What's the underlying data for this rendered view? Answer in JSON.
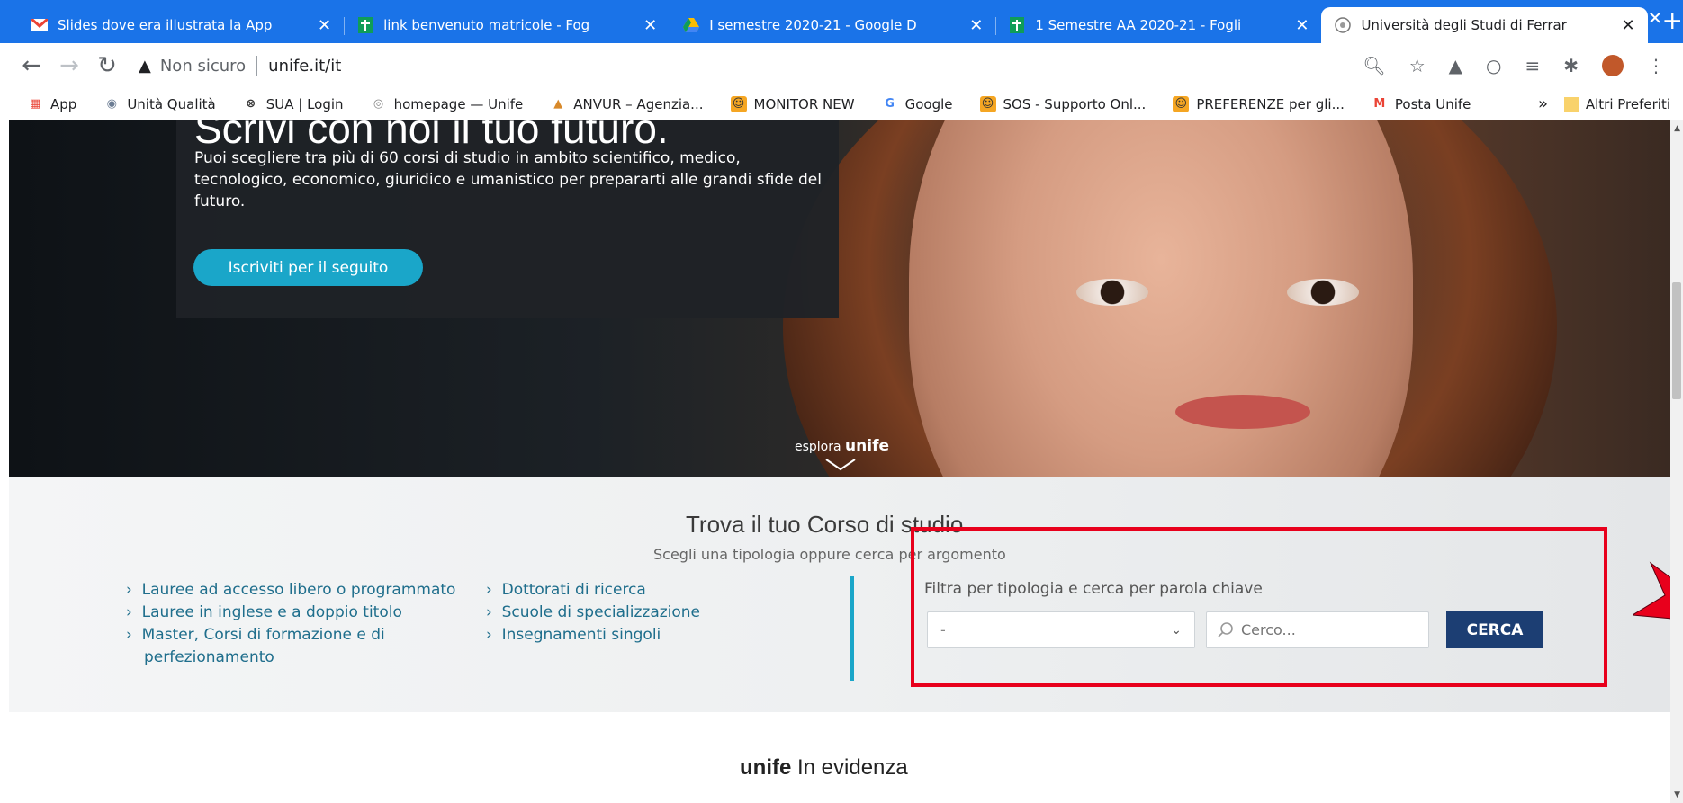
{
  "browser": {
    "tabs": [
      {
        "title": "Slides dove era illustrata la App",
        "icon": "gmail-icon"
      },
      {
        "title": "link benvenuto matricole - Fog",
        "icon": "sheets-icon"
      },
      {
        "title": "I semestre 2020-21 - Google D",
        "icon": "drive-icon"
      },
      {
        "title": "1 Semestre AA 2020-21 - Fogli",
        "icon": "sheets-icon"
      },
      {
        "title": "Università degli Studi di Ferrar",
        "icon": "unife-icon"
      }
    ],
    "security": "Non sicuro",
    "url": "unife.it/it",
    "bookmarks": [
      "App",
      "Unità Qualità",
      "SUA | Login",
      "homepage — Unife",
      "ANVUR – Agenzia...",
      "MONITOR NEW",
      "Google",
      "SOS - Supporto Onl...",
      "PREFERENZE per gli...",
      "Posta Unife"
    ],
    "bookmarks_more": "»",
    "other_bookmarks": "Altri Preferiti"
  },
  "hero": {
    "heading": "Scrivi con noi il tuo futuro.",
    "text": "Puoi scegliere tra più di 60 corsi di studio in ambito scientifico, medico, tecnologico, economico, giuridico e umanistico per prepararti alle grandi sfide del futuro.",
    "button": "Iscriviti per il seguito",
    "explore_prefix": "esplora",
    "explore_brand": "unife"
  },
  "finder": {
    "title": "Trova il tuo Corso di studio",
    "subtitle": "Scegli una tipologia oppure cerca per argomento",
    "links_col1": [
      "Lauree ad accesso libero o programmato",
      "Lauree in inglese e a doppio titolo",
      "Master, Corsi di formazione e di",
      "perfezionamento"
    ],
    "links_col2": [
      "Dottorati di ricerca",
      "Scuole di specializzazione",
      "Insegnamenti singoli"
    ],
    "filter_label": "Filtra per tipologia e cerca per parola chiave",
    "select_value": "-",
    "search_placeholder": "Cerco...",
    "search_button": "CERCA"
  },
  "evidenza": {
    "brand": "unife",
    "label": "In evidenza"
  },
  "colors": {
    "accent": "#1aa6c9",
    "button": "#1c3e73",
    "highlight": "#e8001c"
  }
}
